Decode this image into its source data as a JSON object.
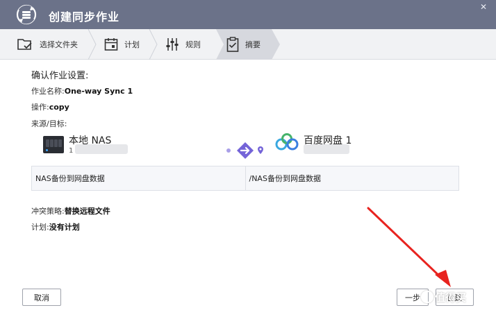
{
  "window": {
    "title": "创建同步作业",
    "close_glyph": "✕"
  },
  "steps": [
    {
      "label": "选择文件夹",
      "icon": "folder-check-icon"
    },
    {
      "label": "计划",
      "icon": "calendar-icon"
    },
    {
      "label": "规则",
      "icon": "sliders-icon"
    },
    {
      "label": "摘要",
      "icon": "clipboard-icon",
      "active": true
    }
  ],
  "summary": {
    "heading": "确认作业设置:",
    "job_name_label": "作业名称:",
    "job_name_value": "One-way Sync 1",
    "operation_label": "操作:",
    "operation_value": "copy",
    "source_target_label": "来源/目标:",
    "source_name": "本地 NAS",
    "source_sub": "1",
    "destination_name": "百度网盘 1",
    "source_path": "NAS备份到网盘数据",
    "destination_path": "/NAS备份到网盘数据",
    "conflict_label": "冲突策略:",
    "conflict_value": "替换远程文件",
    "schedule_label": "计划:",
    "schedule_value": "没有计划"
  },
  "buttons": {
    "cancel": "取消",
    "back": "一步",
    "next": "创建"
  },
  "watermark": "值得买",
  "colors": {
    "titlebar": "#6b7289",
    "flow_accent": "#7464d8",
    "arrow": "#e8231f"
  }
}
